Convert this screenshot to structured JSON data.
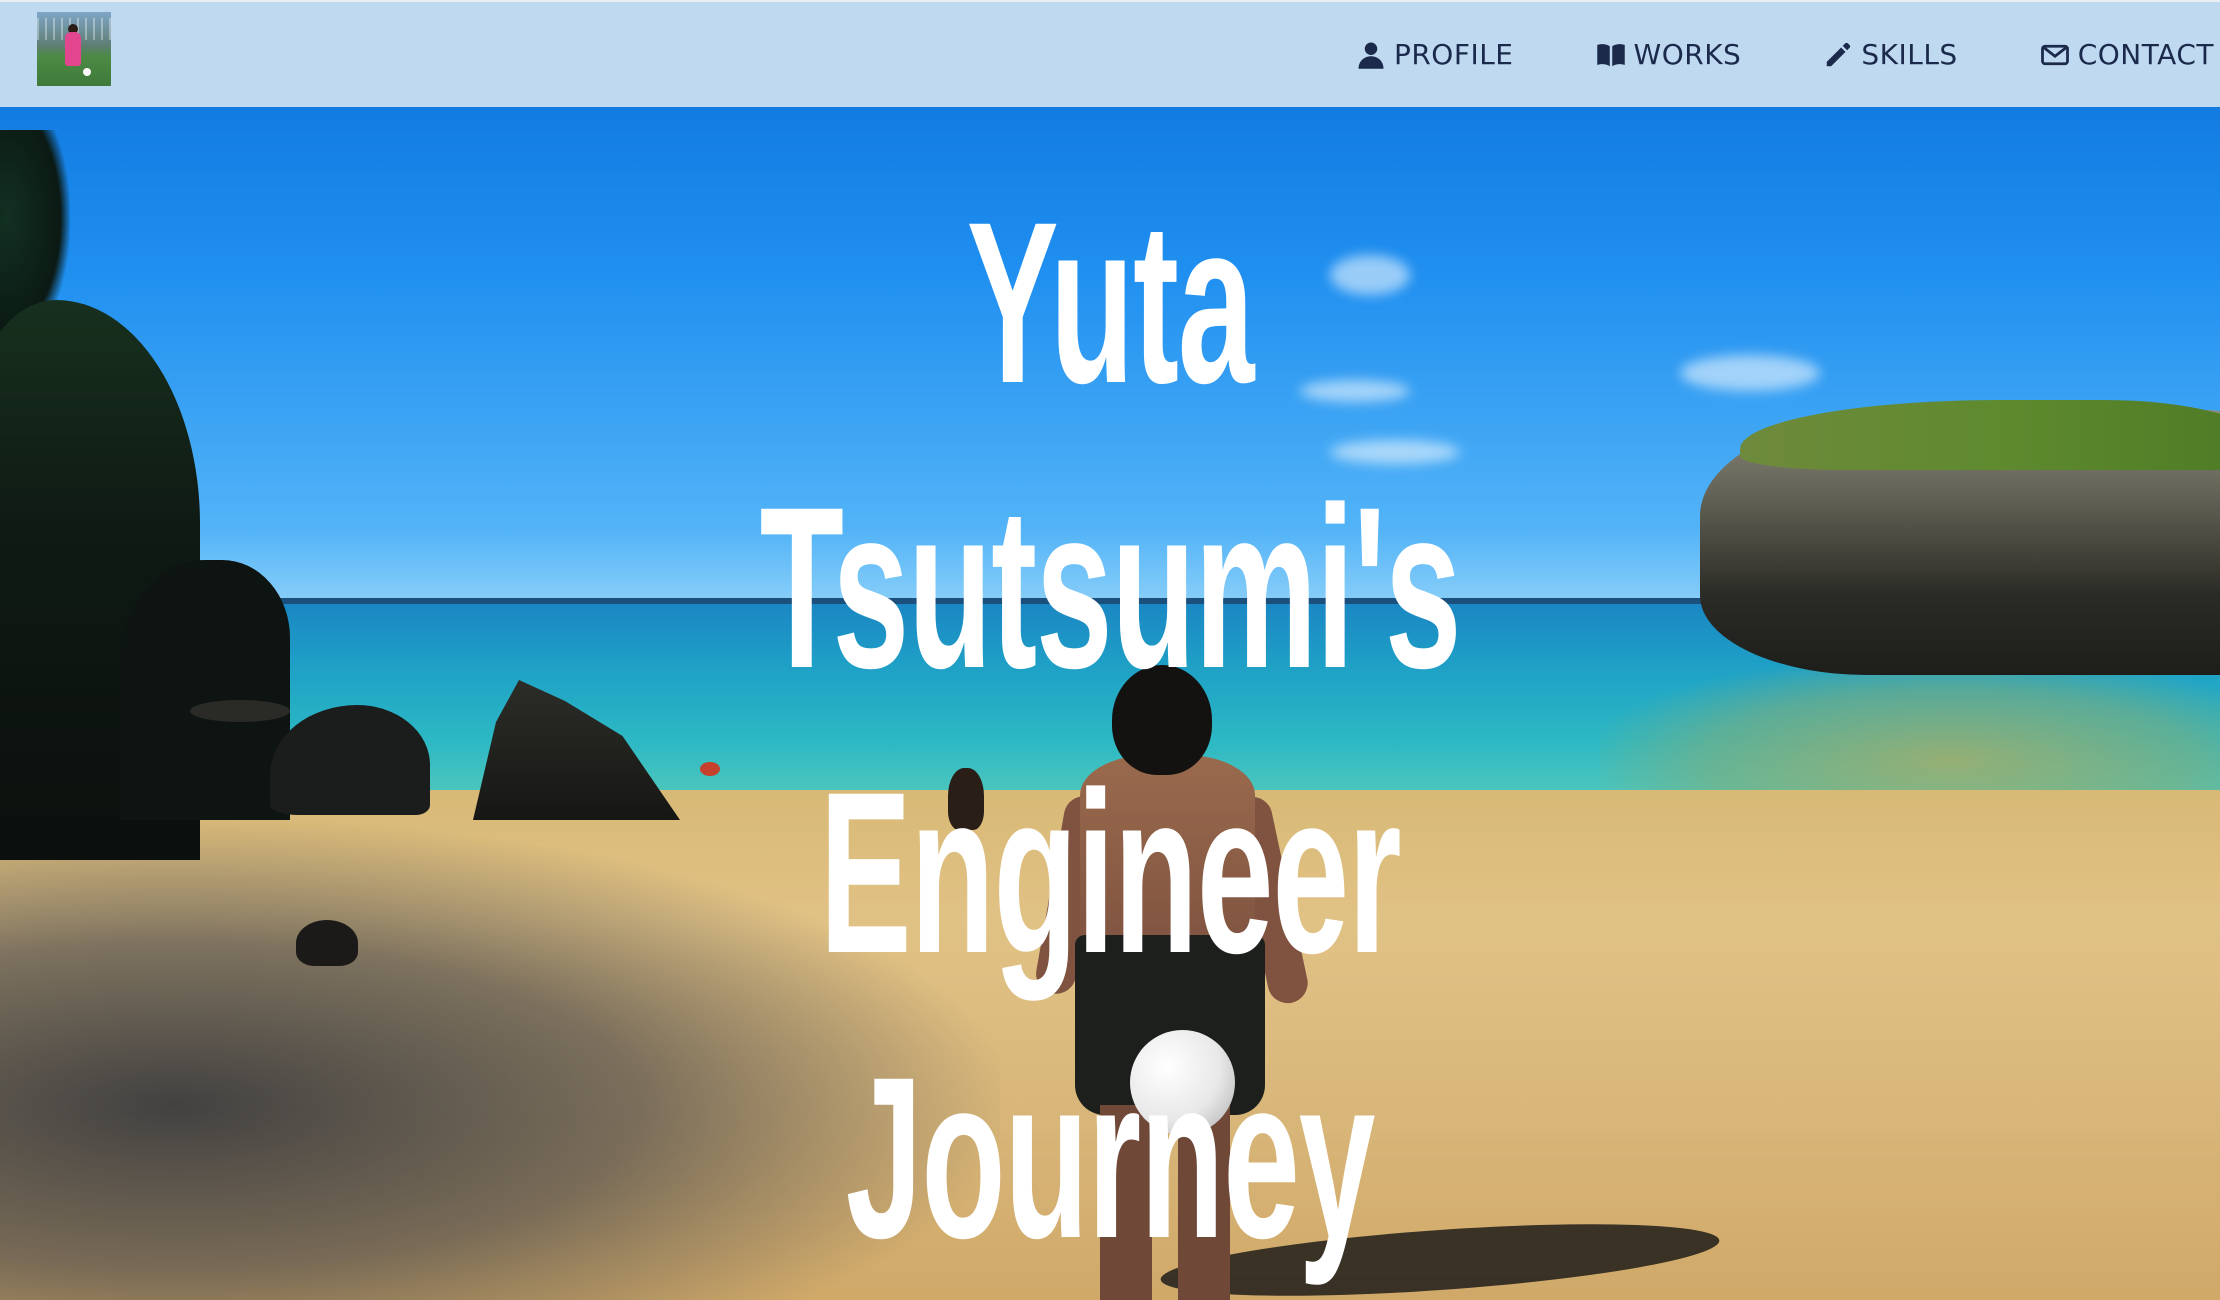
{
  "site": {
    "logo_alt": "profile thumbnail",
    "hero_image": "beach-soccer-photo"
  },
  "nav": {
    "items": [
      {
        "label": "PROFILE",
        "icon": "user-icon"
      },
      {
        "label": "WORKS",
        "icon": "book-icon"
      },
      {
        "label": "SKILLS",
        "icon": "pencil-icon"
      },
      {
        "label": "CONTACT",
        "icon": "envelope-icon"
      }
    ]
  },
  "hero": {
    "title_lines": [
      "Yuta",
      "Tsutsumi's",
      "Engineer",
      "Journey"
    ]
  },
  "colors": {
    "navbar_bg": "#bfd9f1",
    "nav_text": "#1b2a4a",
    "title_text": "#ffffff"
  }
}
